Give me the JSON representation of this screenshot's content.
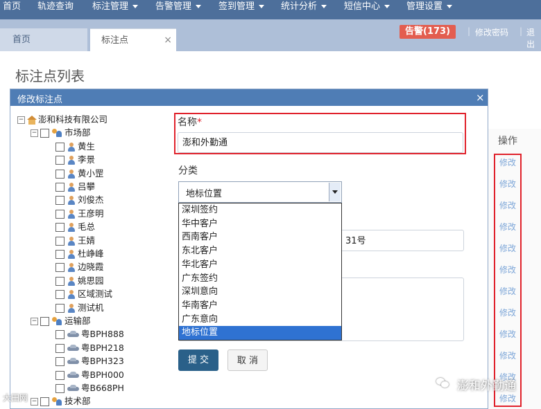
{
  "nav": {
    "items": [
      {
        "label": "首页",
        "dropdown": false
      },
      {
        "label": "轨迹查询",
        "dropdown": false
      },
      {
        "label": "标注管理",
        "dropdown": true
      },
      {
        "label": "告警管理",
        "dropdown": true
      },
      {
        "label": "签到管理",
        "dropdown": true
      },
      {
        "label": "统计分析",
        "dropdown": true
      },
      {
        "label": "短信中心",
        "dropdown": true
      },
      {
        "label": "管理设置",
        "dropdown": true
      }
    ]
  },
  "tabs": {
    "home": "首页",
    "active": "标注点",
    "close": "×"
  },
  "header_right": {
    "alarm": "告警(173)",
    "change_password": "修改密码",
    "logout": "退出",
    "separator": "|"
  },
  "page": {
    "title": "标注点列表"
  },
  "table": {
    "ops_header": "操作",
    "row_action": "修改"
  },
  "dialog": {
    "title": "修改标注点",
    "close": "×",
    "tree": {
      "root": "澎和科技有限公司",
      "departments": [
        {
          "name": "市场部",
          "members": [
            "黄生",
            "李景",
            "黄小罡",
            "吕攀",
            "刘俊杰",
            "王彦明",
            "毛总",
            "王婧",
            "杜峥峰",
            "边晓霞",
            "姚思园",
            "区域测试",
            "测试机"
          ]
        },
        {
          "name": "运输部",
          "members": [
            "粤BPH888",
            "粤BPH218",
            "粤BPH323",
            "粤BPH000",
            "粤B668PH"
          ]
        },
        {
          "name": "技术部",
          "members": []
        }
      ],
      "expander_open": "−"
    },
    "form": {
      "name_label": "名称",
      "required_mark": "*",
      "name_value": "澎和外勤通",
      "category_label": "分类",
      "category_selected": "地标位置",
      "category_options": [
        "深圳签约",
        "华中客户",
        "西南客户",
        "东北客户",
        "华北客户",
        "广东签约",
        "深圳意向",
        "华南客户",
        "广东意向",
        "地标位置"
      ],
      "address_partial": "31号",
      "submit": "提 交",
      "cancel": "取 消"
    }
  },
  "watermark": {
    "text": "澎和外勤通",
    "small": "大田网"
  },
  "colors": {
    "topnav": "#4d6f9b",
    "dialog_header": "#4f7db5",
    "alarm": "#e35d4f",
    "highlight_red": "#e0212b",
    "selected_option": "#2f72d2",
    "submit_button": "#2a6089",
    "link": "#7da6d8"
  }
}
